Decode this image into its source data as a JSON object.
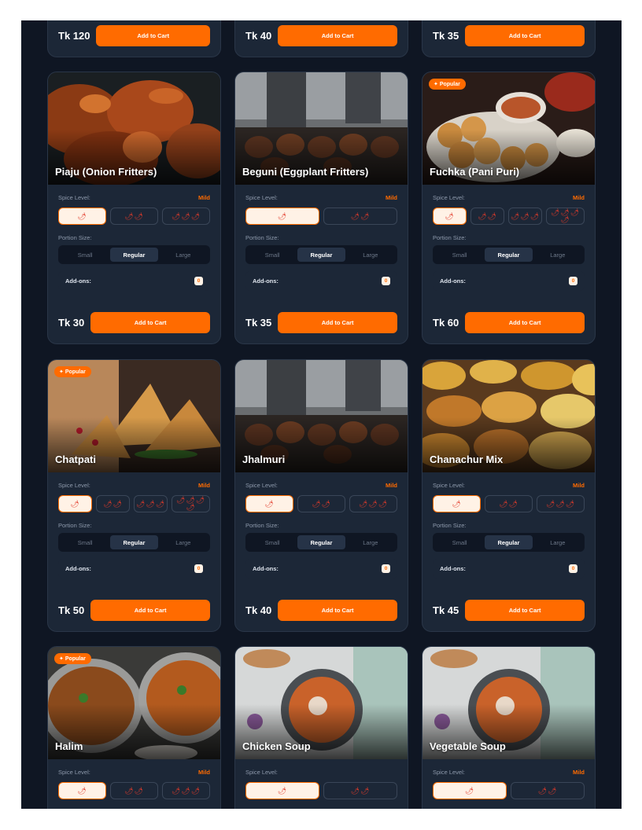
{
  "colors": {
    "background": "#0f1623",
    "card": "#1c2737",
    "accent": "#ff6b00",
    "chili": "#e23b2a"
  },
  "labels": {
    "spice_level": "Spice Level:",
    "portion_size": "Portion Size:",
    "addons": "Add-ons:",
    "add_to_cart": "Add to Cart",
    "popular": "Popular",
    "mild": "Mild",
    "addon_count": "0"
  },
  "portion_options": [
    "Small",
    "Regular",
    "Large"
  ],
  "top_row": [
    {
      "price": "Tk 120"
    },
    {
      "price": "Tk 40"
    },
    {
      "price": "Tk 35"
    }
  ],
  "items": [
    {
      "name": "Piaju (Onion Fritters)",
      "price": "Tk 30",
      "popular": false,
      "spice_options": [
        "🌶",
        "🌶🌶",
        "🌶🌶🌶"
      ],
      "spice_selected": "Mild",
      "portion_selected": "Regular"
    },
    {
      "name": "Beguni (Eggplant Fritters)",
      "price": "Tk 35",
      "popular": false,
      "spice_options": [
        "🌶",
        "🌶🌶"
      ],
      "spice_selected": "Mild",
      "portion_selected": "Regular"
    },
    {
      "name": "Fuchka (Pani Puri)",
      "price": "Tk 60",
      "popular": true,
      "spice_options": [
        "🌶",
        "🌶🌶",
        "🌶🌶🌶",
        "🌶🌶🌶🌶"
      ],
      "spice_selected": "Mild",
      "portion_selected": "Regular"
    },
    {
      "name": "Chatpati",
      "price": "Tk 50",
      "popular": true,
      "spice_options": [
        "🌶",
        "🌶🌶",
        "🌶🌶🌶",
        "🌶🌶🌶🌶"
      ],
      "spice_selected": "Mild",
      "portion_selected": "Regular"
    },
    {
      "name": "Jhalmuri",
      "price": "Tk 40",
      "popular": false,
      "spice_options": [
        "🌶",
        "🌶🌶",
        "🌶🌶🌶"
      ],
      "spice_selected": "Mild",
      "portion_selected": "Regular"
    },
    {
      "name": "Chanachur Mix",
      "price": "Tk 45",
      "popular": false,
      "spice_options": [
        "🌶",
        "🌶🌶",
        "🌶🌶🌶"
      ],
      "spice_selected": "Mild",
      "portion_selected": "Regular"
    },
    {
      "name": "Halim",
      "price": "",
      "popular": true,
      "spice_options": [
        "🌶",
        "🌶🌶",
        "🌶🌶🌶"
      ],
      "spice_selected": "Mild",
      "portion_selected": "Regular"
    },
    {
      "name": "Chicken Soup",
      "price": "",
      "popular": false,
      "spice_options": [
        "🌶",
        "🌶🌶"
      ],
      "spice_selected": "",
      "portion_selected": "Regular"
    },
    {
      "name": "Vegetable Soup",
      "price": "",
      "popular": false,
      "spice_options": [
        "🌶",
        "🌶🌶"
      ],
      "spice_selected": "Mild",
      "portion_selected": "Regular"
    }
  ]
}
